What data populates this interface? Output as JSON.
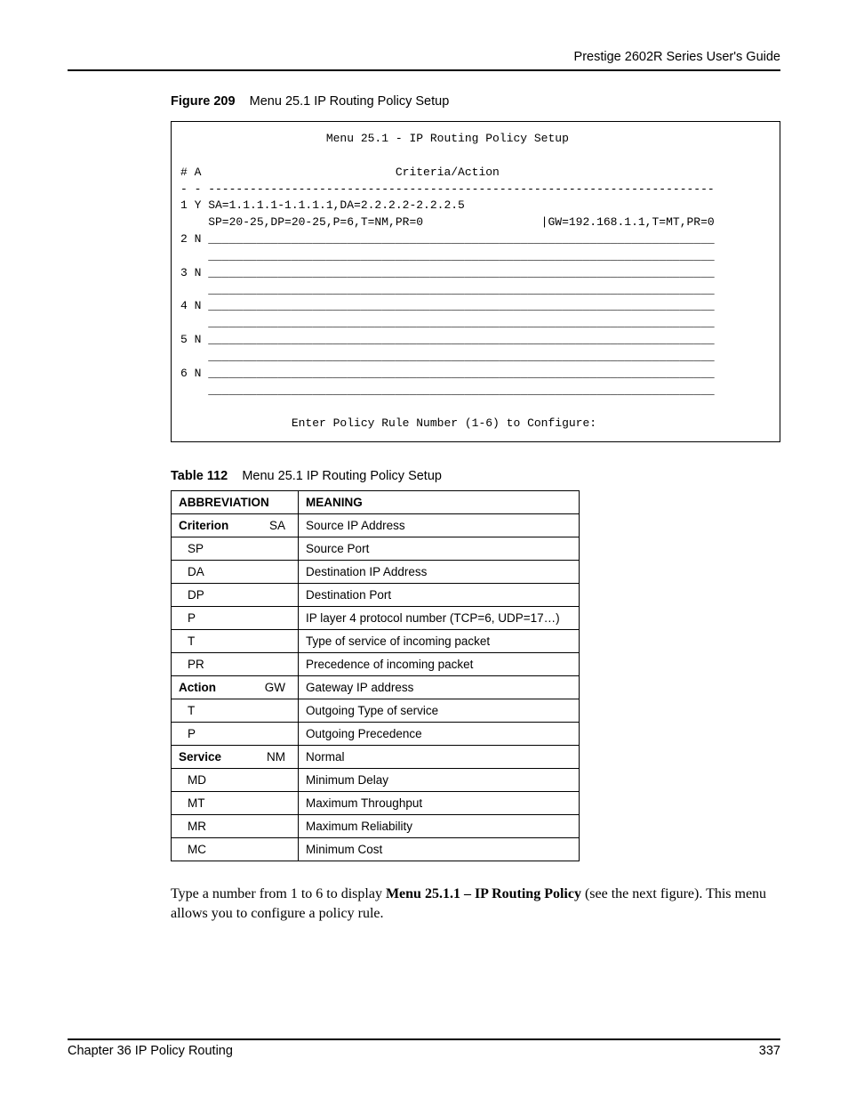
{
  "header": {
    "title": "Prestige 2602R Series User's Guide"
  },
  "figure": {
    "label": "Figure 209",
    "caption": "Menu 25.1 IP Routing Policy Setup"
  },
  "terminal": {
    "title": "Menu 25.1 - IP Routing Policy Setup",
    "col_header_left": "# A",
    "col_header_right": "Criteria/Action",
    "dash_left": "- -",
    "dash_right": "-------------------------------------------------------------------------",
    "rule1_line1_left": "1 Y SA=1.1.1.1-1.1.1.1,DA=2.2.2.2-2.2.2.5",
    "rule1_line2_left": "    SP=20-25,DP=20-25,P=6,T=NM,PR=0",
    "rule1_line2_right": "|GW=192.168.1.1,T=MT,PR=0",
    "row2": "2 N",
    "row3": "3 N",
    "row4": "4 N",
    "row5": "5 N",
    "row6": "6 N",
    "underline": "_________________________________________________________________________",
    "prompt": "Enter Policy Rule Number (1-6) to Configure:"
  },
  "table": {
    "label": "Table 112",
    "caption": "Menu 25.1 IP Routing Policy Setup",
    "head": {
      "c1": "ABBREVIATION",
      "c2": "MEANING"
    },
    "rows": [
      {
        "group": "Criterion",
        "abbr": "SA",
        "meaning": "Source IP Address"
      },
      {
        "abbr": "SP",
        "meaning": "Source Port"
      },
      {
        "abbr": "DA",
        "meaning": "Destination IP Address"
      },
      {
        "abbr": "DP",
        "meaning": "Destination Port"
      },
      {
        "abbr": "P",
        "meaning": "IP layer 4 protocol number (TCP=6, UDP=17…)"
      },
      {
        "abbr": "T",
        "meaning": "Type of service of incoming packet"
      },
      {
        "abbr": "PR",
        "meaning": "Precedence of incoming packet"
      },
      {
        "group": "Action",
        "abbr": "GW",
        "meaning": "Gateway IP address"
      },
      {
        "abbr": "T",
        "meaning": "Outgoing Type of service"
      },
      {
        "abbr": "P",
        "meaning": "Outgoing Precedence"
      },
      {
        "group": "Service",
        "abbr": "NM",
        "meaning": "Normal"
      },
      {
        "abbr": "MD",
        "meaning": "Minimum Delay"
      },
      {
        "abbr": "MT",
        "meaning": "Maximum Throughput"
      },
      {
        "abbr": "MR",
        "meaning": "Maximum Reliability"
      },
      {
        "abbr": "MC",
        "meaning": "Minimum Cost"
      }
    ]
  },
  "paragraph": {
    "pre": "Type a number from 1 to 6 to display ",
    "bold": "Menu 25.1.1 – IP Routing Policy",
    "post": " (see the next figure). This menu allows you to configure a policy rule."
  },
  "footer": {
    "left": "Chapter 36 IP Policy Routing",
    "right": "337"
  }
}
